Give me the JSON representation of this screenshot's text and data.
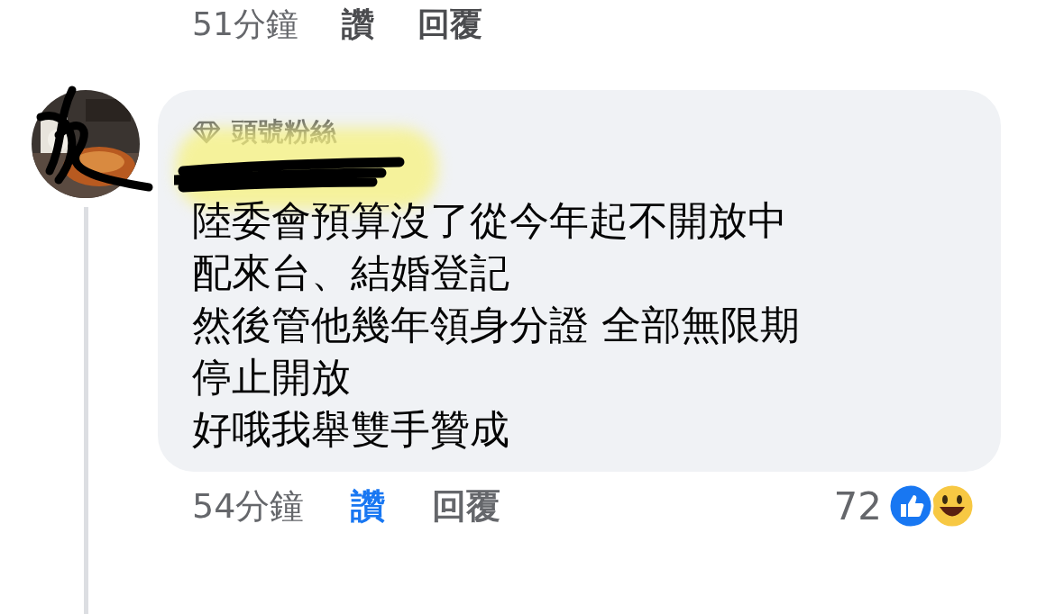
{
  "previous_comment": {
    "time": "51分鐘",
    "like": {
      "label": "讚",
      "selected": false
    },
    "reply": "回覆"
  },
  "comment": {
    "badge": "頭號粉絲",
    "text_lines": [
      "陸委會預算沒了從今年起不開放中配來台、結婚登記",
      "然後管他幾年領身分證 全部無限期停止開放",
      "好哦我舉雙手贊成"
    ],
    "time": "54分鐘",
    "like": {
      "label": "讚",
      "selected": true
    },
    "reply": "回覆",
    "reaction_count": "72"
  }
}
